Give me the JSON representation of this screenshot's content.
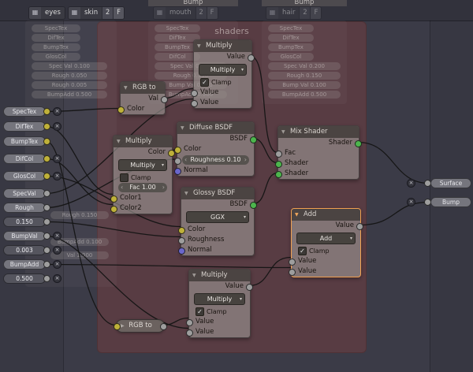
{
  "header": {
    "eyes_label": "eyes",
    "skin_name": "skin",
    "skin_users": "2",
    "skin_fake": "F",
    "mouth_name": "mouth",
    "mouth_users": "2",
    "mouth_fake": "F",
    "hair_name": "hair",
    "hair_users": "2",
    "hair_fake": "F",
    "clipped_label_1": "Bump",
    "clipped_label_2": "Bump"
  },
  "frame": {
    "title": "shaders"
  },
  "group_input": {
    "rows": [
      "SpecTex",
      "DifTex",
      "BumpTex",
      "DifCol",
      "GlosCol",
      "SpecVal",
      "Rough",
      "0.150",
      "BumpVal",
      "0.003",
      "BumpAdd",
      "0.500"
    ]
  },
  "group_output": {
    "surface": "Surface",
    "bump": "Bump"
  },
  "nodes": {
    "rgb_top": {
      "title": "RGB to",
      "out": "Val",
      "in": "Color"
    },
    "mix_color": {
      "title": "Multiply",
      "out": "Color",
      "mode": "Multiply",
      "clamp": "Clamp",
      "clamp_check": "",
      "fac": "Fac 1.00",
      "in1": "Color1",
      "in2": "Color2"
    },
    "math_top": {
      "title": "Multiply",
      "out": "Value",
      "mode": "Multiply",
      "clamp": "Clamp",
      "clamp_check": "✓",
      "in1": "Value",
      "in2": "Value"
    },
    "diffuse": {
      "title": "Diffuse BSDF",
      "out": "BSDF",
      "color": "Color",
      "roughness": "Roughness 0.10",
      "normal": "Normal"
    },
    "glossy": {
      "title": "Glossy BSDF",
      "out": "BSDF",
      "dist": "GGX",
      "color": "Color",
      "roughness": "Roughness",
      "normal": "Normal"
    },
    "mix_shader": {
      "title": "Mix Shader",
      "out": "Shader",
      "fac": "Fac",
      "in1": "Shader",
      "in2": "Shader"
    },
    "math_add": {
      "title": "Add",
      "out": "Value",
      "mode": "Add",
      "clamp": "Clamp",
      "clamp_check": "✓",
      "in1": "Value",
      "in2": "Value"
    },
    "math_bottom": {
      "title": "Multiply",
      "out": "Value",
      "mode": "Multiply",
      "clamp": "Clamp",
      "clamp_check": "✓",
      "in1": "Value",
      "in2": "Value"
    },
    "rgb_bottom": {
      "title": "RGB to"
    }
  },
  "faded": {
    "panel_a": [
      "SpecTex",
      "DifTex",
      "BumpTex",
      "GlosCol",
      "Spec Val 0.100",
      "Rough 0.050",
      "Rough 0.005",
      "BumpAdd 0.500"
    ],
    "panel_a_lower": [
      "Rough 0.150",
      "BumpAdd 0.100",
      "Val 1.000"
    ],
    "panel_b": [
      "SpecTex",
      "DifTex",
      "BumpTex",
      "DifCol",
      "Spec Val 0.200",
      "Rough 0.150",
      "Bump Val 0.100",
      "BumpAdd 0.500"
    ],
    "panel_c": [
      "SpecTex",
      "DifTex",
      "BumpTex",
      "GlosCol",
      "Spec Val 0.200",
      "Rough 0.150",
      "Bump Val 0.100",
      "BumpAdd 0.500"
    ]
  },
  "icons": {
    "collapse_open": "▼",
    "collapse_closed": "▶",
    "dropdown": "▾",
    "hidden": "×",
    "slider_left": "‹",
    "slider_right": "›",
    "nodetree": "▦"
  },
  "colors": {
    "background": "#3b3b47",
    "frame": "#5a3e44",
    "selection": "#f0a050",
    "socket_color": "#bfb13a",
    "socket_value": "#9e9e9e",
    "socket_shader": "#4db54d",
    "socket_vector": "#6b67cb"
  }
}
